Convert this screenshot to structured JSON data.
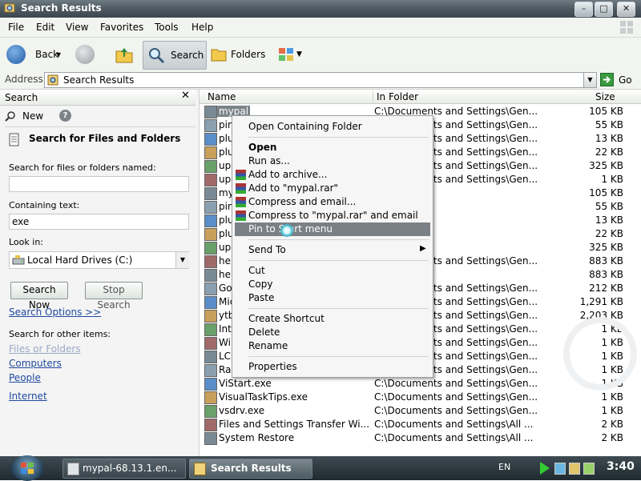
{
  "window": {
    "title": "Search Results"
  },
  "menu": [
    "File",
    "Edit",
    "View",
    "Favorites",
    "Tools",
    "Help"
  ],
  "toolbar": {
    "back": "Back",
    "search": "Search",
    "folders": "Folders"
  },
  "address": {
    "label": "Address",
    "value": "Search Results",
    "go": "Go"
  },
  "search_pane": {
    "header": "Search",
    "new_label": "New",
    "heading": "Search for Files and Folders",
    "named_label": "Search for files or folders named:",
    "named_value": "",
    "containing_label": "Containing text:",
    "containing_value": "exe",
    "lookin_label": "Look in:",
    "lookin_value": "Local Hard Drives (C:)",
    "search_now": "Search Now",
    "stop_search": "Stop Search",
    "search_options": "Search Options >>",
    "other_label": "Search for other items:",
    "other_links": [
      "Files or Folders",
      "Computers",
      "People"
    ],
    "internet": "Internet"
  },
  "columns": {
    "name": "Name",
    "folder": "In Folder",
    "size": "Size"
  },
  "files": [
    {
      "name": "mypal",
      "folder": "C:\\Documents and Settings\\Gen...",
      "size": "105 KB"
    },
    {
      "name": "pin",
      "folder": "C:\\Documents and Settings\\Gen...",
      "size": "55 KB"
    },
    {
      "name": "plu",
      "folder": "C:\\Documents and Settings\\Gen...",
      "size": "13 KB"
    },
    {
      "name": "plu",
      "folder": "C:\\Documents and Settings\\Gen...",
      "size": "22 KB"
    },
    {
      "name": "upc",
      "folder": "C:\\Documents and Settings\\Gen...",
      "size": "325 KB"
    },
    {
      "name": "upc",
      "folder": "C:\\Documents and Settings\\Gen...",
      "size": "1 KB"
    },
    {
      "name": "myp",
      "folder": "",
      "size": "105 KB"
    },
    {
      "name": "pin",
      "folder": "",
      "size": "55 KB"
    },
    {
      "name": "plu",
      "folder": "",
      "size": "13 KB"
    },
    {
      "name": "plu",
      "folder": "",
      "size": "22 KB"
    },
    {
      "name": "upc",
      "folder": "",
      "size": "325 KB"
    },
    {
      "name": "hel",
      "folder": "C:\\Documents and Settings\\Gen...",
      "size": "883 KB"
    },
    {
      "name": "hel",
      "folder": "...tall",
      "size": "883 KB"
    },
    {
      "name": "Go",
      "folder": "C:\\Documents and Settings\\Gen...",
      "size": "212 KB"
    },
    {
      "name": "Mic",
      "folder": "C:\\Documents and Settings\\Gen...",
      "size": "1,291 KB"
    },
    {
      "name": "ytb",
      "folder": "C:\\Documents and Settings\\Gen...",
      "size": "2,203 KB"
    },
    {
      "name": "Int",
      "folder": "C:\\Documents and Settings\\Gen...",
      "size": "1 KB"
    },
    {
      "name": "Wi",
      "folder": "C:\\Documents and Settings\\Gen...",
      "size": "1 KB"
    },
    {
      "name": "LC",
      "folder": "C:\\Documents and Settings\\Gen...",
      "size": "1 KB"
    },
    {
      "name": "Ra",
      "folder": "C:\\Documents and Settings\\Gen...",
      "size": "1 KB"
    },
    {
      "name": "ViStart.exe",
      "folder": "C:\\Documents and Settings\\Gen...",
      "size": "1 KB"
    },
    {
      "name": "VisualTaskTips.exe",
      "folder": "C:\\Documents and Settings\\Gen...",
      "size": "1 KB"
    },
    {
      "name": "vsdrv.exe",
      "folder": "C:\\Documents and Settings\\Gen...",
      "size": "1 KB"
    },
    {
      "name": "Files and Settings Transfer Wi...",
      "folder": "C:\\Documents and Settings\\All ...",
      "size": "2 KB"
    },
    {
      "name": "System Restore",
      "folder": "C:\\Documents and Settings\\All ...",
      "size": "2 KB"
    }
  ],
  "context_menu": {
    "open_folder": "Open Containing Folder",
    "open": "Open",
    "run_as": "Run as...",
    "add_archive": "Add to archive...",
    "add_rar": "Add to \"mypal.rar\"",
    "compress_email": "Compress and email...",
    "compress_rar_email": "Compress to \"mypal.rar\" and email",
    "pin_start": "Pin to Start menu",
    "send_to": "Send To",
    "cut": "Cut",
    "copy": "Copy",
    "paste": "Paste",
    "create_shortcut": "Create Shortcut",
    "delete": "Delete",
    "rename": "Rename",
    "properties": "Properties"
  },
  "taskbar": {
    "task1": "mypal-68.13.1.en...",
    "task2": "Search Results",
    "language": "EN",
    "clock": "3:40"
  }
}
